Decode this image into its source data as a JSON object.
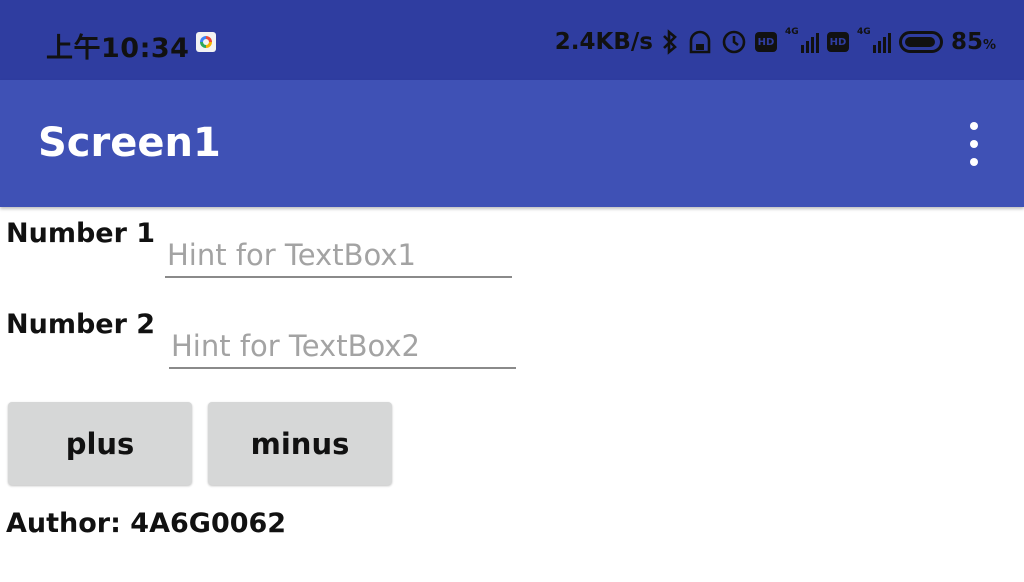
{
  "status_bar": {
    "time": "上午10:34",
    "network_speed": "2.4KB/s",
    "battery_percent": "85",
    "battery_unit": "%",
    "signal_label_1": "4G",
    "signal_label_2": "4G",
    "hd_label_1": "HD",
    "hd_label_2": "HD",
    "icons": [
      "notification-app-icon",
      "bluetooth-icon",
      "vpn-lock-icon",
      "alarm-clock-icon",
      "hd-volte-icon",
      "signal-4g-icon",
      "hd-volte-icon",
      "signal-4g-icon",
      "battery-icon"
    ]
  },
  "app_bar": {
    "title": "Screen1",
    "menu_icon": "more-vert-icon"
  },
  "form": {
    "number1_label": "Number 1",
    "textbox1_hint": "Hint for TextBox1",
    "textbox1_value": "",
    "number2_label": "Number 2",
    "textbox2_hint": "Hint for TextBox2",
    "textbox2_value": "",
    "plus_label": "plus",
    "minus_label": "minus",
    "author_text": "Author: 4A6G0062"
  },
  "colors": {
    "status_bar": "#2f3da0",
    "app_bar": "#3f51b5",
    "button": "#d6d7d7",
    "underline": "#8a8a8a"
  }
}
